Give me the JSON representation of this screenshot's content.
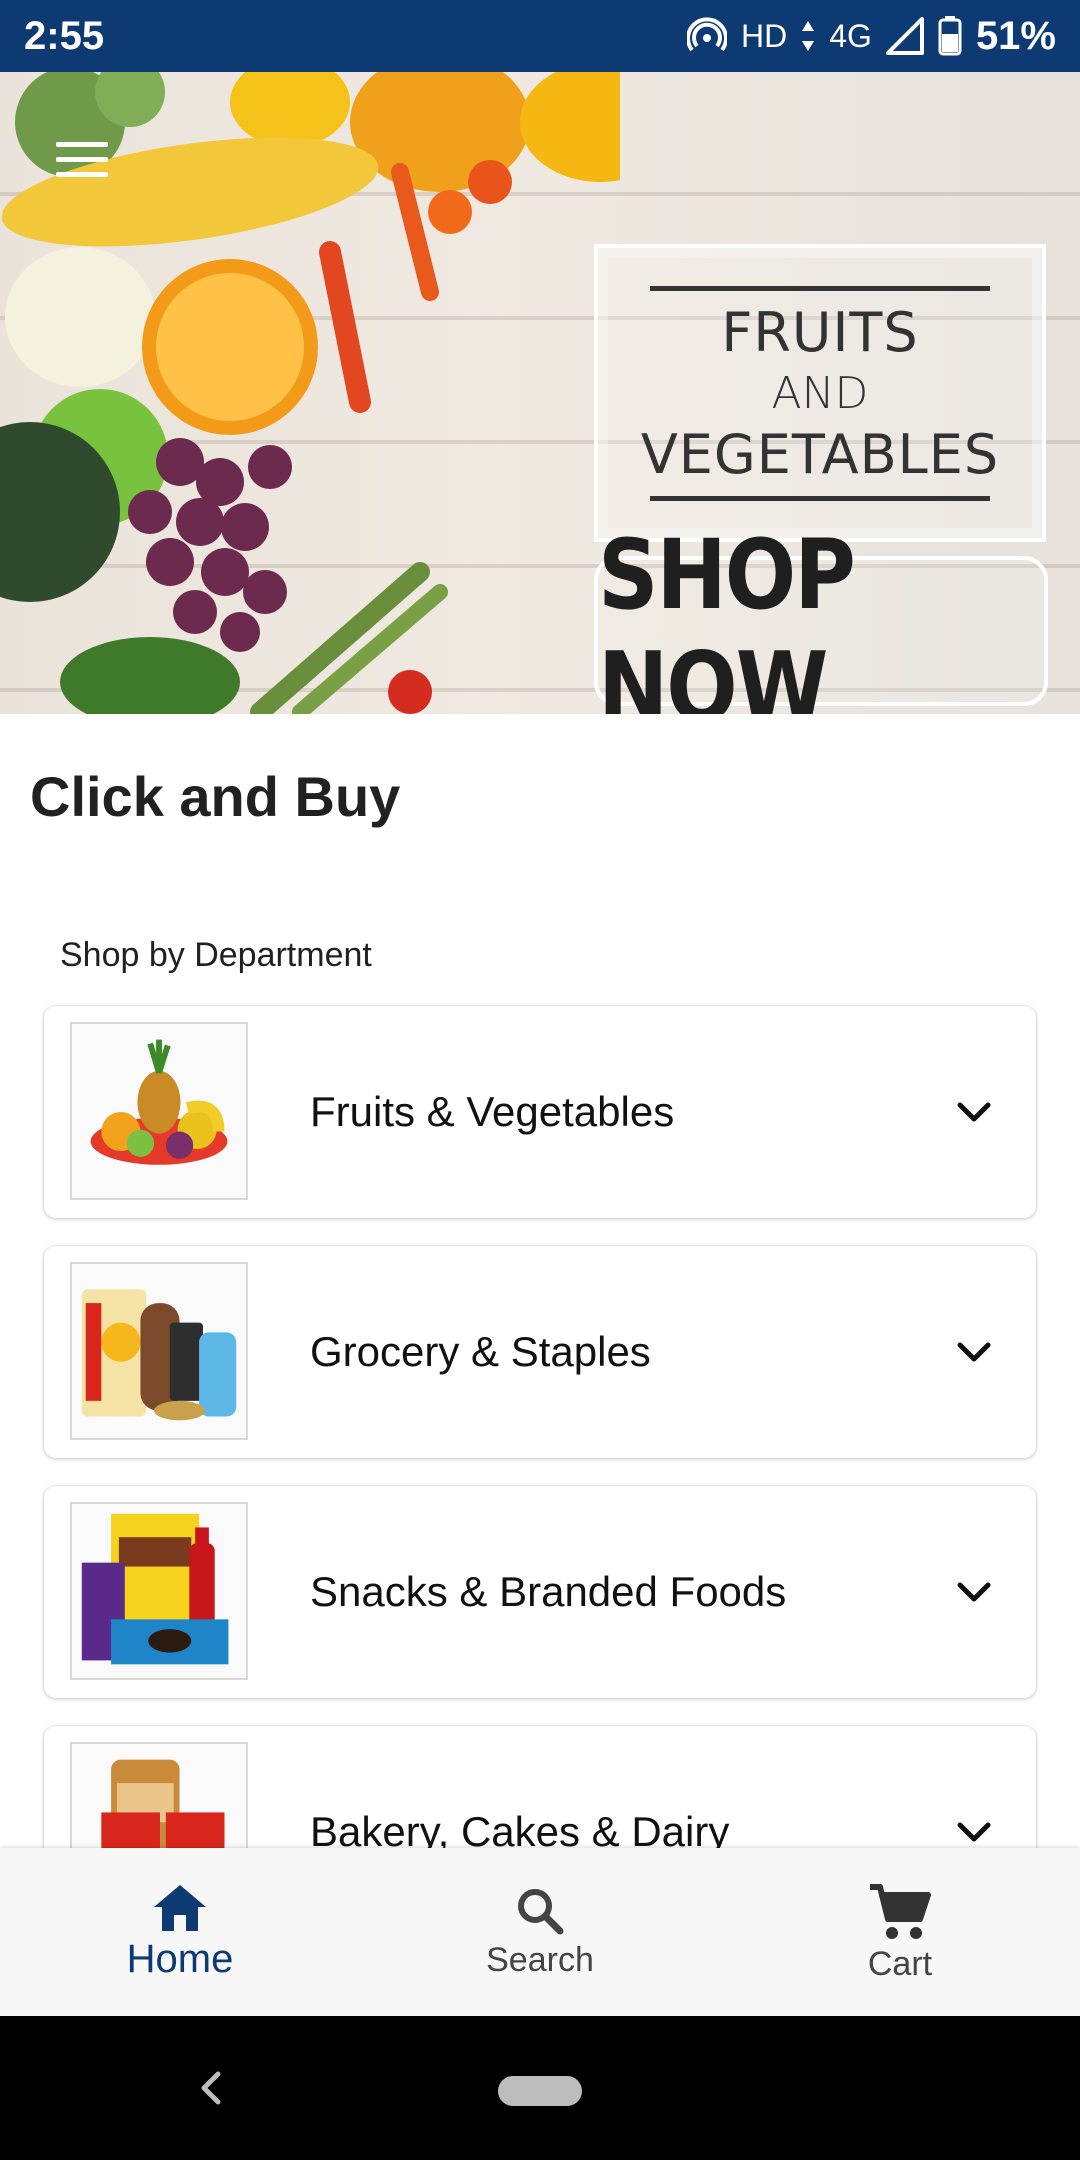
{
  "status_bar": {
    "time": "2:55",
    "network_hd": "HD",
    "network_type": "4G",
    "battery_percent": "51%"
  },
  "banner": {
    "line1": "FRUITS",
    "line2": "AND",
    "line3": "VEGETABLES",
    "cta_label": "SHOP NOW"
  },
  "app": {
    "title": "Click and Buy"
  },
  "departments": {
    "section_label": "Shop by Department",
    "items": [
      {
        "label": "Fruits & Vegetables",
        "icon": "fruits-vegetables-image"
      },
      {
        "label": "Grocery & Staples",
        "icon": "grocery-staples-image"
      },
      {
        "label": "Snacks & Branded Foods",
        "icon": "snacks-branded-foods-image"
      },
      {
        "label": "Bakery, Cakes & Dairy",
        "icon": "bakery-cakes-dairy-image"
      }
    ]
  },
  "bottom_nav": {
    "items": [
      {
        "label": "Home",
        "icon": "home-icon",
        "active": true
      },
      {
        "label": "Search",
        "icon": "search-icon",
        "active": false
      },
      {
        "label": "Cart",
        "icon": "cart-icon",
        "active": false
      }
    ]
  },
  "colors": {
    "status_bar": "#0e3a73",
    "accent": "#0e3a73",
    "nav_background": "#f7f7f7",
    "system_nav": "#000000"
  }
}
